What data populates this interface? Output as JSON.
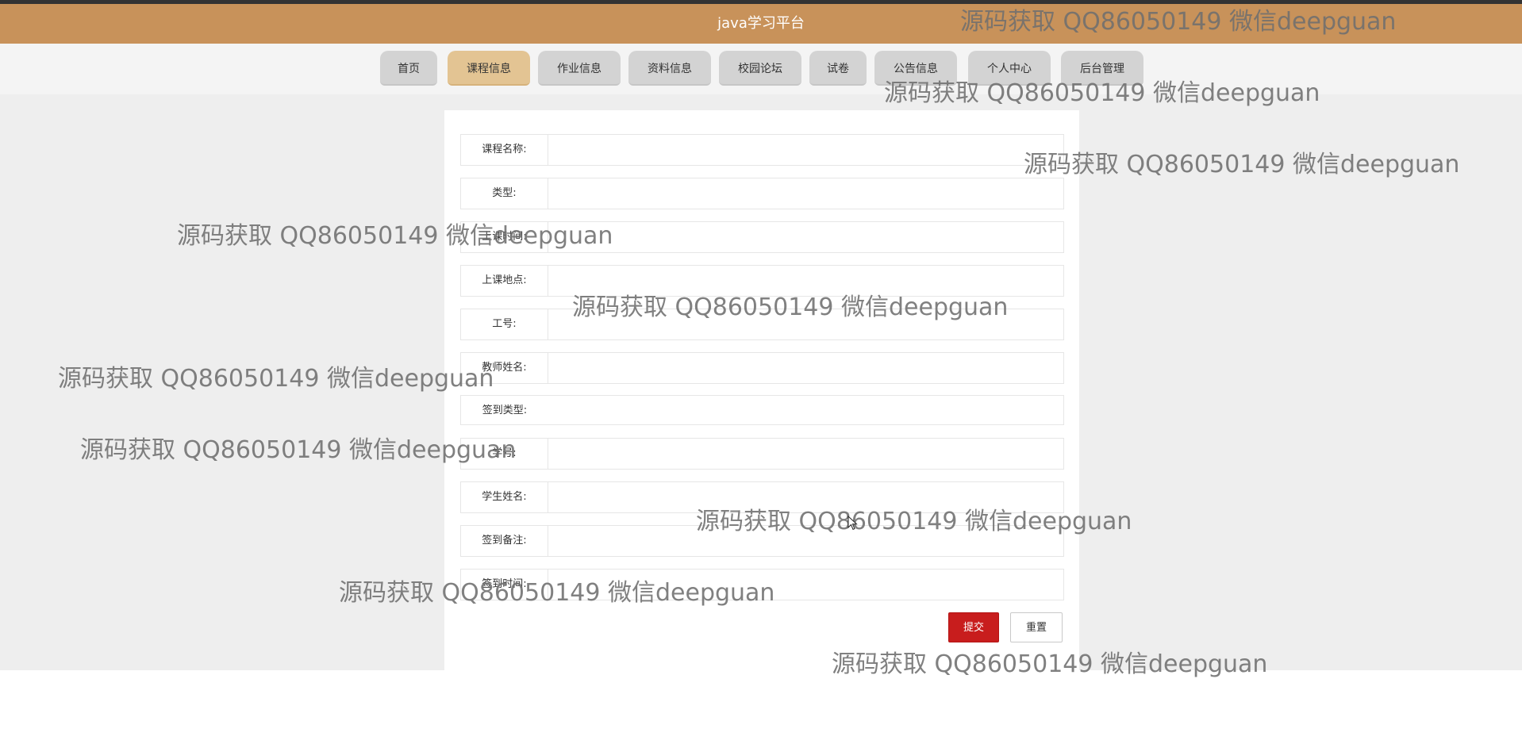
{
  "header": {
    "title": "java学习平台"
  },
  "nav": {
    "tabs": [
      {
        "label": "首页"
      },
      {
        "label": "课程信息",
        "active": true
      },
      {
        "label": "作业信息"
      },
      {
        "label": "资料信息"
      },
      {
        "label": "校园论坛"
      },
      {
        "label": "试卷"
      },
      {
        "label": "公告信息"
      },
      {
        "label": "个人中心"
      },
      {
        "label": "后台管理"
      }
    ]
  },
  "form": {
    "fields": [
      {
        "label": "课程名称:",
        "value": ""
      },
      {
        "label": "类型:",
        "value": ""
      },
      {
        "label": "上课时间:",
        "value": ""
      },
      {
        "label": "上课地点:",
        "value": ""
      },
      {
        "label": "工号:",
        "value": ""
      },
      {
        "label": "教师姓名:",
        "value": ""
      },
      {
        "label": "签到类型:",
        "value": ""
      },
      {
        "label": "学号:",
        "value": ""
      },
      {
        "label": "学生姓名:",
        "value": ""
      },
      {
        "label": "签到备注:",
        "value": ""
      },
      {
        "label": "签到时间:",
        "value": ""
      }
    ],
    "submit_label": "提交",
    "reset_label": "重置"
  },
  "watermark": {
    "text": "源码获取 QQ86050149 微信deepguan"
  },
  "colors": {
    "header": "#c8925a",
    "active_tab": "#e3c493",
    "tab": "#d3d3d3",
    "submit_button": "#c81d1d"
  }
}
